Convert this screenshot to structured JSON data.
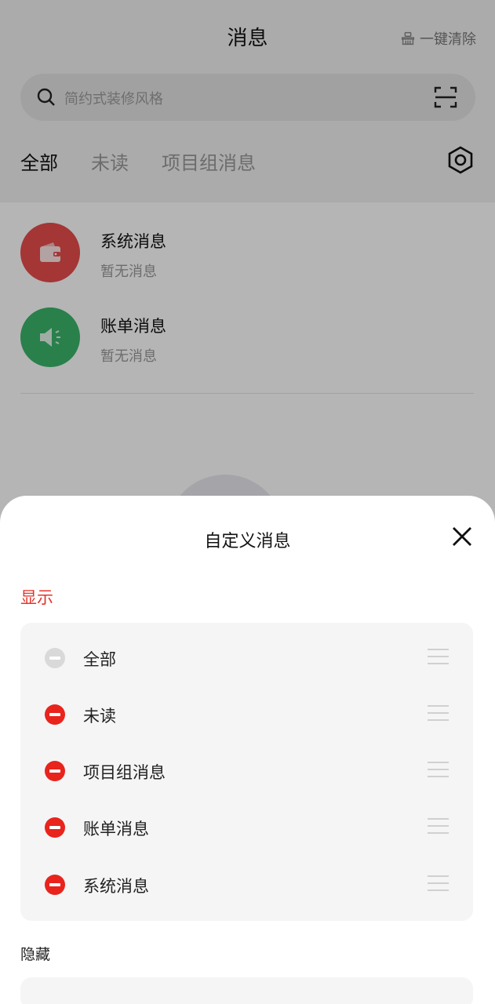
{
  "header": {
    "title": "消息",
    "clear_all_label": "一键清除",
    "clear_icon": "broom-icon"
  },
  "search": {
    "placeholder": "简约式装修风格",
    "icon": "search-icon",
    "scan_icon": "scan-icon"
  },
  "tabs": [
    {
      "label": "全部",
      "active": true
    },
    {
      "label": "未读",
      "active": false
    },
    {
      "label": "项目组消息",
      "active": false
    }
  ],
  "settings_icon": "hexagon-settings-icon",
  "messages": [
    {
      "title": "系统消息",
      "subtitle": "暂无消息",
      "icon": "wallet-icon",
      "color": "#e84c4c"
    },
    {
      "title": "账单消息",
      "subtitle": "暂无消息",
      "icon": "speaker-icon",
      "color": "#3bb56a"
    }
  ],
  "sheet": {
    "title": "自定义消息",
    "close_icon": "close-icon",
    "show_label": "显示",
    "hide_label": "隐藏",
    "shown_items": [
      {
        "label": "全部",
        "removable": false
      },
      {
        "label": "未读",
        "removable": true
      },
      {
        "label": "项目组消息",
        "removable": true
      },
      {
        "label": "账单消息",
        "removable": true
      },
      {
        "label": "系统消息",
        "removable": true
      }
    ]
  },
  "colors": {
    "accent": "#e5332b",
    "remove_red": "#e8241d",
    "disabled_gray": "#d9d9d9"
  }
}
